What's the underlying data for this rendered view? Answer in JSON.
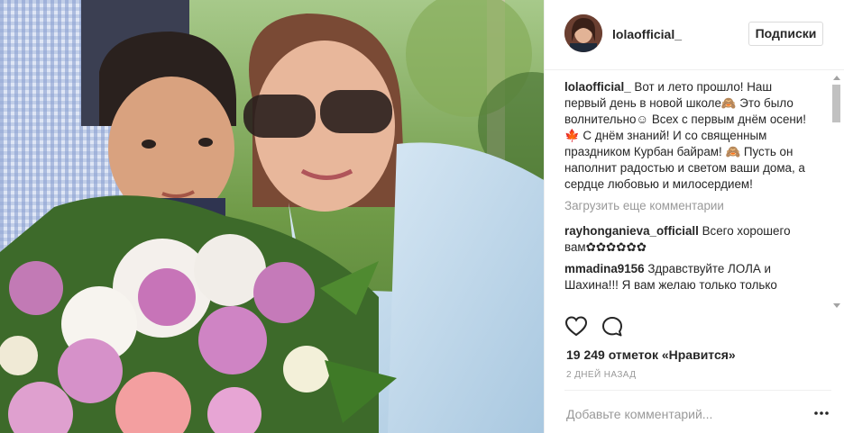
{
  "post": {
    "username": "lolaofficial_",
    "follow_label": "Подписки",
    "caption": {
      "user": "lolaofficial_",
      "text": "Вот и лето прошло! Наш первый день в новой школе🙈 Это было волнительно☺ Всех с первым днём осени!🍁 С днём знаний! И со священным праздником Курбан байрам! 🙈 Пусть он наполнит радостью и светом ваши дома, а сердце любовью и милосердием!"
    },
    "load_more_label": "Загрузить еще комментарии",
    "comments": [
      {
        "user": "rayhonganieva_officiall",
        "text": "Всего хорошего вам✿✿✿✿✿✿"
      },
      {
        "user": "mmadina9156",
        "text": "Здравствуйте ЛОЛА и Шахина!!! Я вам желаю только только"
      }
    ],
    "likes_text": "19 249 отметок «Нравится»",
    "time_text": "2 ДНЕЙ НАЗАД",
    "add_comment_placeholder": "Добавьте комментарий...",
    "icons": {
      "like": "heart-icon",
      "comment": "comment-icon",
      "more": "more-options-icon"
    }
  },
  "colors": {
    "text": "#262626",
    "secondary": "#999999",
    "border": "#efefef"
  }
}
